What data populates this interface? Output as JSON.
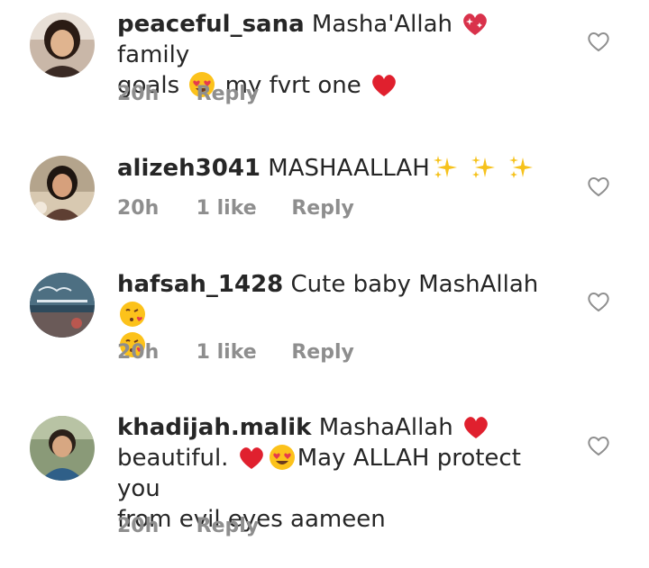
{
  "comments": [
    {
      "username": "peaceful_sana",
      "text_parts": [
        "Masha'Allah",
        "family",
        "goals",
        "my fvrt one"
      ],
      "icons": [
        "sparkling-heart-emoji",
        "heart-eyes-emoji",
        "red-heart-emoji"
      ],
      "time": "20h",
      "reply_label": "Reply"
    },
    {
      "username": "alizeh3041",
      "text_parts": [
        "MASHAALLAH"
      ],
      "icons": [
        "sparkles-emoji",
        "sparkles-emoji",
        "sparkles-emoji"
      ],
      "time": "20h",
      "likes": "1 like",
      "reply_label": "Reply"
    },
    {
      "username": "hafsah_1428",
      "text_parts": [
        "Cute baby MashAllah"
      ],
      "icons": [
        "kissing-heart-emoji",
        "kissing-heart-emoji"
      ],
      "time": "20h",
      "likes": "1 like",
      "reply_label": "Reply"
    },
    {
      "username": "khadijah.malik",
      "text_parts": [
        "MashaAllah",
        "beautiful.",
        "May ALLAH protect you",
        "from evil eyes aameen"
      ],
      "icons": [
        "red-heart-emoji",
        "red-heart-emoji",
        "heart-eyes-emoji"
      ],
      "time": "20h",
      "reply_label": "Reply"
    }
  ],
  "colors": {
    "text": "#262626",
    "meta": "#8e8e8e",
    "heart": "#ed2939"
  }
}
